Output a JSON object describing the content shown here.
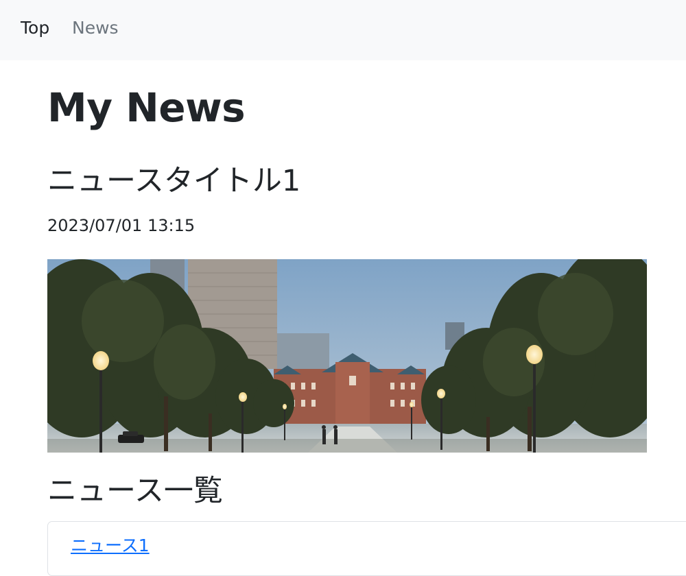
{
  "navbar": {
    "brand_label": "Top",
    "news_label": "News"
  },
  "page": {
    "title": "My News"
  },
  "article": {
    "title": "ニュースタイトル1",
    "date": "2023/07/01 13:15",
    "image": {
      "description": "photo-of-brick-station-plaza-with-trees-and-street-lamps"
    }
  },
  "news_list": {
    "heading": "ニュース一覧",
    "items": [
      {
        "label": "ニュース1"
      }
    ]
  },
  "colors": {
    "navbar_bg": "#f8f9fa",
    "text": "#212529",
    "muted": "#6c757d",
    "link": "#0d6efd",
    "border": "#dee2e6"
  }
}
